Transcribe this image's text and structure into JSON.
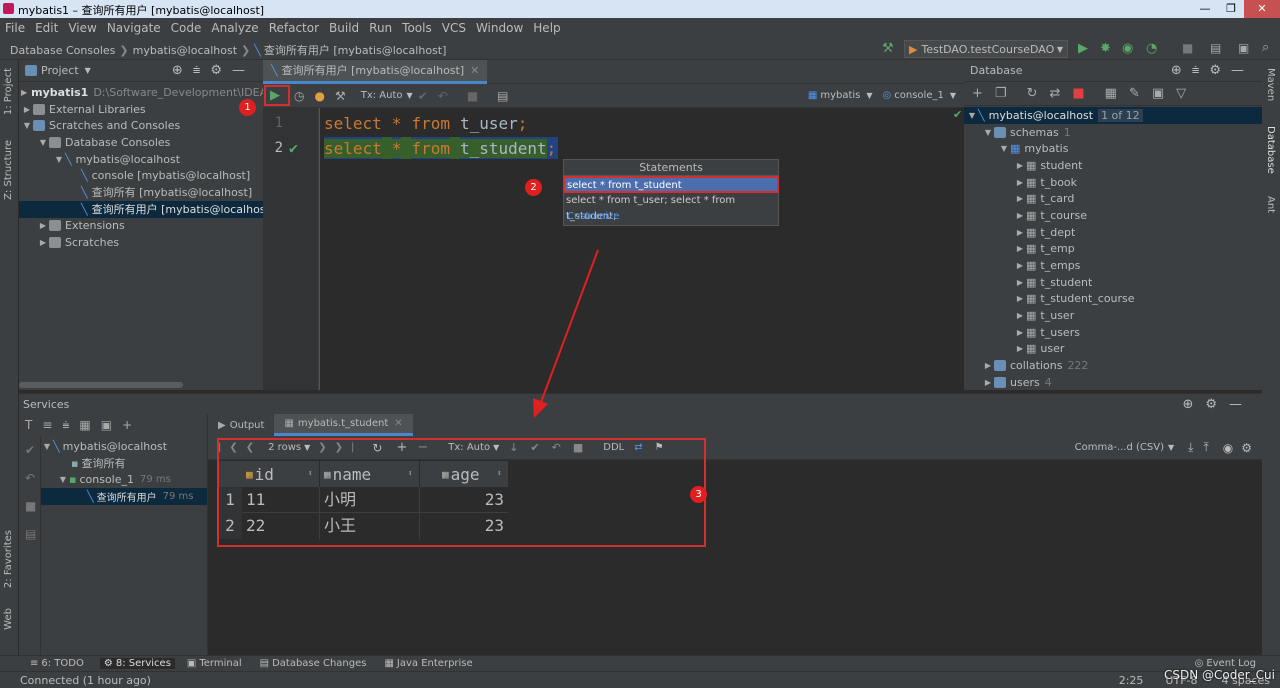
{
  "window": {
    "title": "mybatis1 – 查询所有用户 [mybatis@localhost]",
    "min": "—",
    "max": "❐",
    "close": "✕"
  },
  "menu": [
    "File",
    "Edit",
    "View",
    "Navigate",
    "Code",
    "Analyze",
    "Refactor",
    "Build",
    "Run",
    "Tools",
    "VCS",
    "Window",
    "Help"
  ],
  "breadcrumb": [
    "Database Consoles",
    "mybatis@localhost",
    "查询所有用户 [mybatis@localhost]"
  ],
  "run_config": "TestDAO.testCourseDAO",
  "left_strip": {
    "project": "1: Project",
    "structure": "Z: Structure",
    "favorites": "2: Favorites",
    "web": "Web"
  },
  "right_strip": {
    "maven": "Maven",
    "database": "Database",
    "ant": "Ant"
  },
  "project": {
    "title": "Project",
    "items": [
      {
        "label": "mybatis1",
        "extra": "D:\\Software_Development\\IDEA_"
      },
      {
        "label": "External Libraries"
      },
      {
        "label": "Scratches and Consoles"
      },
      {
        "label": "Database Consoles"
      },
      {
        "label": "mybatis@localhost"
      },
      {
        "label": "console [mybatis@localhost]"
      },
      {
        "label": "查询所有 [mybatis@localhost]"
      },
      {
        "label": "查询所有用户 [mybatis@localhost]"
      },
      {
        "label": "Extensions"
      },
      {
        "label": "Scratches"
      }
    ]
  },
  "editor": {
    "tab": "查询所有用户 [mybatis@localhost]",
    "tx": "Tx: Auto",
    "schema": "mybatis",
    "console": "console_1",
    "lines": [
      {
        "num": "1",
        "kw1": "select",
        "star": "*",
        "kw2": "from",
        "table": "t_user",
        "semi": ";"
      },
      {
        "num": "2",
        "kw1": "select",
        "star": "*",
        "kw2": "from",
        "table": "t_student",
        "semi": ";"
      }
    ]
  },
  "popup": {
    "header": "Statements",
    "items": [
      "select * from t_student",
      "select * from t_user; select * from t_student;"
    ],
    "customize": "Customize"
  },
  "database": {
    "title": "Database",
    "connection": "mybatis@localhost",
    "connection_badge": "1 of 12",
    "schemas": "schemas",
    "schemas_count": "1",
    "schema": "mybatis",
    "tables": [
      "student",
      "t_book",
      "t_card",
      "t_course",
      "t_dept",
      "t_emp",
      "t_emps",
      "t_student",
      "t_student_course",
      "t_user",
      "t_users",
      "user"
    ],
    "collations": "collations",
    "collations_count": "222",
    "users": "users",
    "users_count": "4"
  },
  "services": {
    "title": "Services",
    "tree": [
      {
        "label": "mybatis@localhost",
        "time": ""
      },
      {
        "label": "查询所有",
        "time": ""
      },
      {
        "label": "console_1",
        "time": "79 ms"
      },
      {
        "label": "查询所有用户",
        "time": "79 ms"
      }
    ],
    "tabs": [
      "Output",
      "mybatis.t_student"
    ],
    "rows_label": "2 rows",
    "tx": "Tx: Auto",
    "ddl": "DDL",
    "export": "Comma-...d (CSV)",
    "columns": [
      "id",
      "name",
      "age"
    ],
    "rows": [
      {
        "n": "1",
        "id": "11",
        "name": "小明",
        "age": "23"
      },
      {
        "n": "2",
        "id": "22",
        "name": "小王",
        "age": "23"
      }
    ]
  },
  "badges": [
    "1",
    "2",
    "3"
  ],
  "bottom_tabs": [
    "6: TODO",
    "8: Services",
    "Terminal",
    "Database Changes",
    "Java Enterprise"
  ],
  "event_log": "Event Log",
  "status": {
    "left": "Connected (1 hour ago)",
    "pos": "2:25",
    "enc": "UTF-8",
    "indent": "4 spaces",
    "watermark": "CSDN @Coder_Cui"
  },
  "colors": {
    "keyword": "#cc7832",
    "selection": "#4b6eaf",
    "highlight": "#214283",
    "badge": "#e02020"
  }
}
